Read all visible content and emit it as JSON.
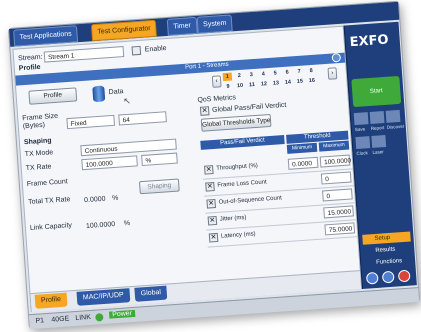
{
  "tabs": [
    "Test Applications",
    "Test Configurator",
    "Timer",
    "System"
  ],
  "active_tab": 1,
  "stream": {
    "label": "Stream:",
    "value": "Stream 1"
  },
  "enable_label": "Enable",
  "port_label": "Port 1 - Streams",
  "profile_section": {
    "title": "Profile",
    "button": "Profile",
    "icon_label": "Data"
  },
  "frame_size": {
    "label": "Frame Size\n(Bytes)",
    "mode": "Fixed",
    "value": "64"
  },
  "shaping": {
    "title": "Shaping",
    "tx_mode_label": "TX Mode",
    "tx_mode_value": "Continuous",
    "tx_rate_label": "TX Rate",
    "tx_rate_value": "100.0000",
    "tx_rate_unit": "%",
    "frame_count_label": "Frame Count",
    "shaping_button": "Shaping",
    "total_tx_label": "Total TX Rate",
    "total_tx_value": "0.0000",
    "total_tx_unit": "%",
    "link_capacity_label": "Link Capacity",
    "link_capacity_value": "100.0000",
    "link_capacity_unit": "%"
  },
  "qos": {
    "title": "QoS Metrics",
    "global_verdict": "Global Pass/Fail Verdict",
    "global_thresholds_button": "Global Thresholds Type",
    "pages": [
      "1",
      "2",
      "3",
      "4",
      "5",
      "6",
      "7",
      "8",
      "9",
      "10",
      "11",
      "12",
      "13",
      "14",
      "15",
      "16"
    ],
    "selected_page": 0
  },
  "thresholds": {
    "header_left": "Pass/Fail Verdict",
    "header_right": "Threshold",
    "min_label": "Minimum",
    "max_label": "Maximum",
    "rows": [
      {
        "label": "Throughput (%)",
        "min": "0.0000",
        "max": "100.0000"
      },
      {
        "label": "Frame Loss Count",
        "min": "",
        "max": "0"
      },
      {
        "label": "Out-of-Sequence Count",
        "min": "",
        "max": "0"
      },
      {
        "label": "Jitter (ms)",
        "min": "",
        "max": "15.0000"
      },
      {
        "label": "Latency (ms)",
        "min": "",
        "max": "75.0000"
      }
    ]
  },
  "bottom_tabs": [
    "Profile",
    "MAC/IP/UDP",
    "Global"
  ],
  "status": {
    "port": "P1",
    "rate": "40GE",
    "link": "LINK",
    "power": "Power"
  },
  "right_panel": {
    "brand": "EXFO",
    "start_label": "Start",
    "small_buttons": [
      "Save",
      "Report",
      "Discover",
      "Clock",
      "Laser"
    ],
    "menu": [
      "Setup",
      "Results",
      "Functions"
    ]
  },
  "colors": {
    "accent": "#f5a623",
    "primary": "#2f5aa8",
    "dark": "#1e3f7c",
    "start": "#3faa3a"
  }
}
